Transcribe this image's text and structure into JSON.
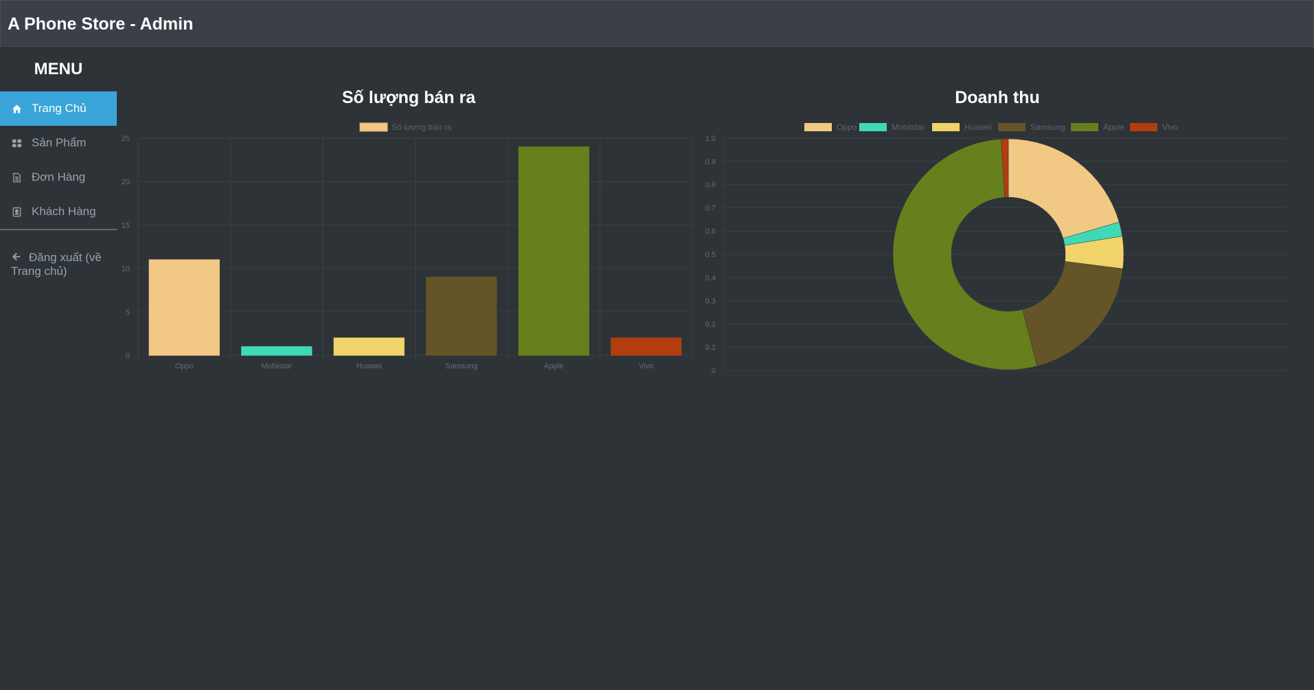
{
  "app": {
    "title": "A Phone Store - Admin"
  },
  "sidebar": {
    "menu_title": "MENU",
    "items": [
      {
        "label": "Trang Chủ",
        "icon": "home-icon",
        "active": true
      },
      {
        "label": "Sản Phẩm",
        "icon": "grid-icon",
        "active": false
      },
      {
        "label": "Đơn Hàng",
        "icon": "document-icon",
        "active": false
      },
      {
        "label": "Khách Hàng",
        "icon": "contact-book-icon",
        "active": false
      }
    ],
    "logout_label": "Đăng xuất (về Trang chủ)"
  },
  "colors": {
    "accent": "#3aa5d8",
    "brands": [
      "#f1c884",
      "#3fd9b8",
      "#f0d46a",
      "#645427",
      "#65801c",
      "#b23d0f"
    ]
  },
  "chart_data": [
    {
      "type": "bar",
      "title": "Số lượng bán ra",
      "categories": [
        "Oppo",
        "Mobiistar",
        "Huawei",
        "Samsung",
        "Apple",
        "Vivo"
      ],
      "series": [
        {
          "name": "Số lượng bán ra",
          "values": [
            11,
            1,
            2,
            9,
            24,
            2
          ]
        }
      ],
      "ylim": [
        0,
        25
      ],
      "yticks": [
        0,
        5,
        10,
        15,
        20,
        25
      ],
      "grid": true,
      "legend_position": "top"
    },
    {
      "type": "pie",
      "subtype": "doughnut",
      "title": "Doanh thu",
      "labels": [
        "Oppo",
        "Mobiistar",
        "Huawei",
        "Samsung",
        "Apple",
        "Vivo"
      ],
      "values": [
        20.5,
        2,
        4.5,
        19,
        53,
        1
      ],
      "axis_ticks": [
        "0",
        "0.1",
        "0.2",
        "0.3",
        "0.4",
        "0.5",
        "0.6",
        "0.7",
        "0.8",
        "0.9",
        "1.0"
      ],
      "grid": true,
      "legend_position": "top"
    }
  ]
}
